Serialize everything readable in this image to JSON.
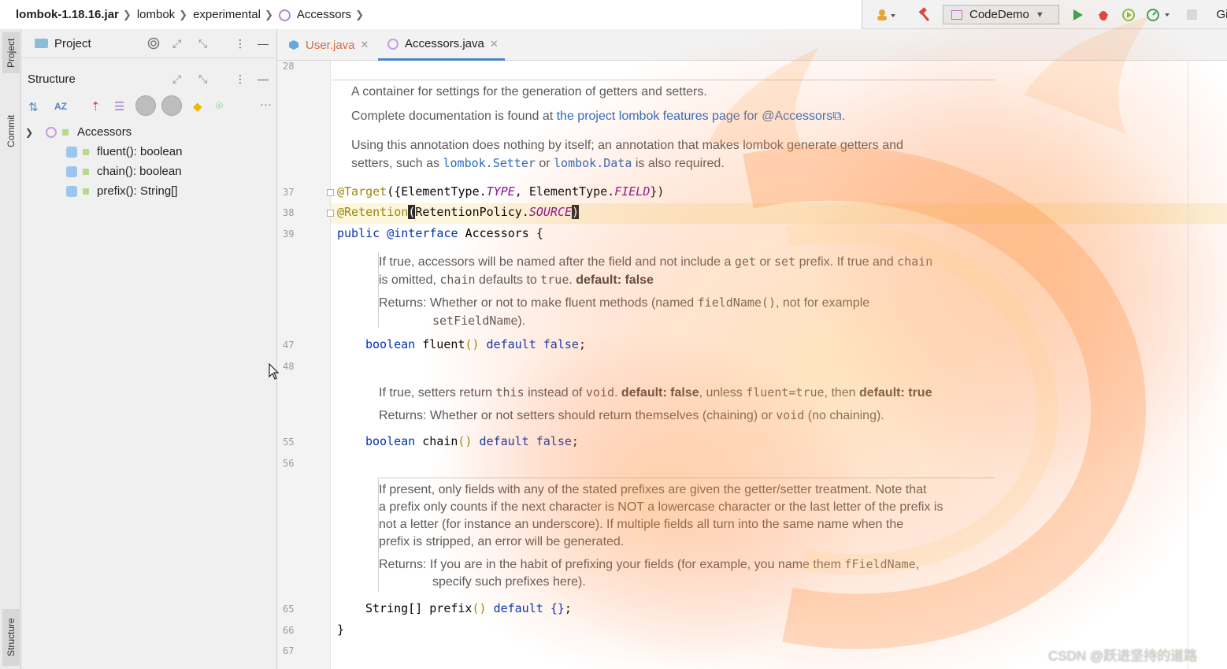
{
  "breadcrumb": {
    "items": [
      "lombok-1.18.16.jar",
      "lombok",
      "experimental",
      "Accessors"
    ]
  },
  "toolbar": {
    "run_config": "CodeDemo",
    "git_label": "Gi"
  },
  "left_stripe": {
    "top_tabs": [
      "Project",
      "Commit"
    ],
    "bottom_tabs": [
      "Structure"
    ]
  },
  "project_panel": {
    "title": "Project"
  },
  "structure_panel": {
    "title": "Structure",
    "root": "Accessors",
    "members": [
      "fluent(): boolean",
      "chain(): boolean",
      "prefix(): String[]"
    ]
  },
  "editor_tabs": [
    {
      "label": "User.java",
      "active": false
    },
    {
      "label": "Accessors.java",
      "active": true
    }
  ],
  "editor": {
    "line_numbers": {
      "l28": "28",
      "l37": "37",
      "l38": "38",
      "l39": "39",
      "l47": "47",
      "l48": "48",
      "l55": "55",
      "l56": "56",
      "l65": "65",
      "l66": "66",
      "l67": "67"
    },
    "doc_class": {
      "p1": "A container for settings for the generation of getters and setters.",
      "p2_text": "Complete documentation is found at ",
      "p2_link": "the project lombok features page for @Accessors",
      "p2_end": ".",
      "p3_a": "Using this annotation does nothing by itself; an annotation that makes lombok generate getters and",
      "p3_b": "setters, such as ",
      "p3_setter": "lombok.Setter",
      "p3_or": " or ",
      "p3_data": "lombok.Data",
      "p3_end": " is also required."
    },
    "code": {
      "target_ann": "@Target",
      "target_open": "({ElementType.",
      "target_type": "TYPE",
      "target_mid": ", ElementType.",
      "target_field": "FIELD",
      "target_close": "})",
      "retention_ann": "@Retention",
      "retention_paren": "(",
      "retention_mid": "RetentionPolicy.",
      "retention_source": "SOURCE",
      "retention_close": ")",
      "iface_public": "public",
      "iface_kw": "@interface",
      "iface_name": "Accessors",
      "iface_brace": "{",
      "fluent_type": "boolean",
      "fluent_name": "fluent",
      "fluent_parens": "()",
      "fluent_default": "default",
      "fluent_val": "false",
      "semi": ";",
      "chain_type": "boolean",
      "chain_name": "chain",
      "prefix_type": "String[]",
      "prefix_name": "prefix",
      "prefix_default_val": "{}",
      "close_brace": "}"
    },
    "doc_fluent": {
      "a1": "If true, accessors will be named after the field and not include a ",
      "a_get": "get",
      "a_or": " or ",
      "a_set": "set",
      "a2": " prefix. If true and ",
      "a_chain": "chain",
      "b1": "is omitted, ",
      "b_chain": "chain",
      "b2": " defaults to ",
      "b_true": "true",
      "b3": ". ",
      "b_default": "default: false",
      "r1": "Returns: Whether or not to make fluent methods (named ",
      "r_fieldname": "fieldName()",
      "r2": ", not for example",
      "r_setfield": "setFieldName",
      "r3": ")."
    },
    "doc_chain": {
      "a1": "If true, setters return ",
      "a_this": "this",
      "a2": " instead of ",
      "a_void": "void",
      "a3": ". ",
      "a_default": "default: false",
      "a4": ", unless ",
      "a_fluent": "fluent=true",
      "a5": ", then ",
      "a_default_true": "default: true",
      "r1": "Returns: Whether or not setters should return themselves (chaining) or ",
      "r_void": "void",
      "r2": " (no chaining)."
    },
    "doc_prefix": {
      "l1": "If present, only fields with any of the stated prefixes are given the getter/setter treatment. Note that",
      "l2": "a prefix only counts if the next character is NOT a lowercase character or the last letter of the prefix is",
      "l3": "not a letter (for instance an underscore). If multiple fields all turn into the same name when the",
      "l4": "prefix is stripped, an error will be generated.",
      "r1": "Returns: If you are in the habit of prefixing your fields (for example, you name them ",
      "r_ffield": "fFieldName",
      "r2": ",",
      "r3": "specify such prefixes here)."
    }
  },
  "watermark": "CSDN @跃进坚持的道路",
  "colors": {
    "keyword": "#0033b3",
    "annotation": "#9e880d",
    "constant": "#871094",
    "link": "#2a6bbf",
    "doc_text": "#5a5a5a",
    "tab_underline": "#4a86c7",
    "current_line": "#fbf6dc"
  }
}
